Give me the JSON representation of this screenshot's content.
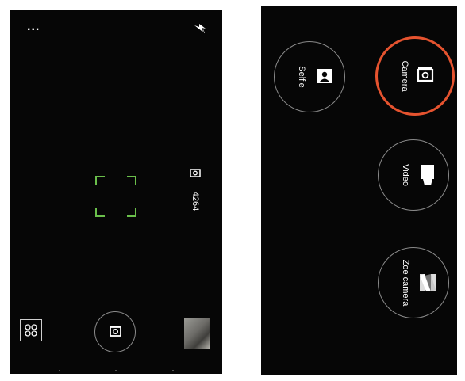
{
  "left_screen": {
    "menu_label": "...",
    "flash_icon": "flash-auto-icon",
    "shots_remaining": "4264",
    "gallery_icon": "grid-icon",
    "shutter_icon": "camera-icon"
  },
  "right_screen": {
    "modes": [
      {
        "label": "Selfie",
        "icon": "selfie-icon",
        "selected": false
      },
      {
        "label": "Camera",
        "icon": "camera-icon",
        "selected": true
      },
      {
        "label": "Video",
        "icon": "video-icon",
        "selected": false
      },
      {
        "label": "Zoe camera",
        "icon": "zoe-icon",
        "selected": false
      }
    ],
    "selected_color": "#e5532f"
  },
  "colors": {
    "focus_box": "#6abf4b",
    "background": "#060606"
  }
}
